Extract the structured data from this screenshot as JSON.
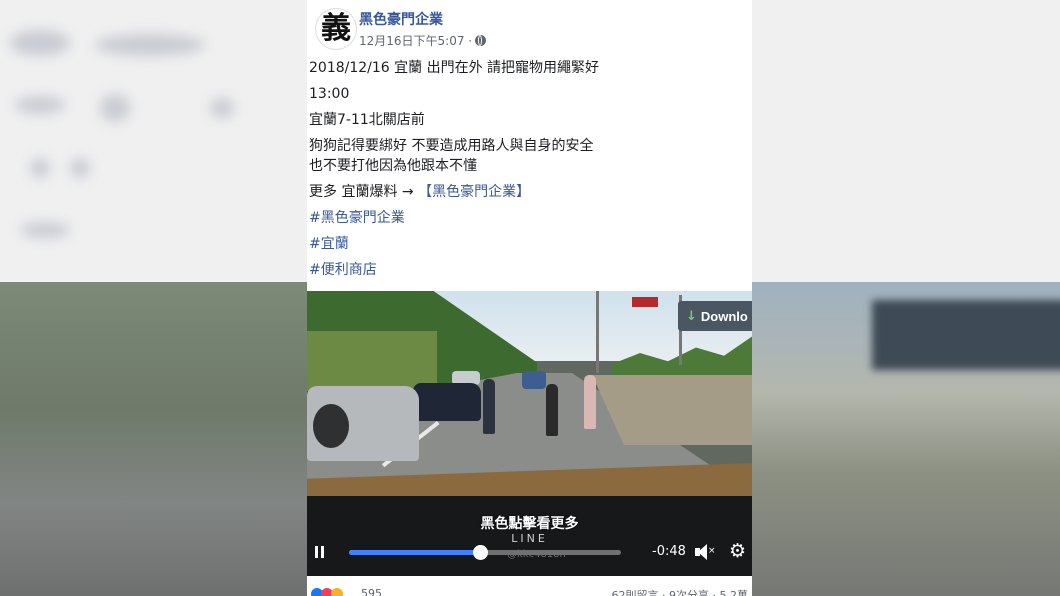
{
  "post": {
    "avatar_char": "義",
    "page_name": "黑色豪門企業",
    "timestamp": "12月16日下午5:07 ·",
    "lines": [
      "2018/12/16 宜蘭 出門在外 請把寵物用繩緊好",
      "13:00",
      "宜蘭7-11北關店前",
      "狗狗記得要綁好 不要造成用路人與自身的安全",
      "也不要打他因為他跟本不懂"
    ],
    "more_prefix": "更多 宜蘭爆料 → ",
    "more_link": "【黑色豪門企業】",
    "hashtags": [
      "#黑色豪門企業",
      "#宜蘭",
      "#便利商店"
    ]
  },
  "video": {
    "download_label": "Downlo",
    "overlay_cta": "黑色點擊看更多",
    "overlay_line": "LINE",
    "overlay_id": "@kkc4818n",
    "time_remaining": "-0:48",
    "progress_fraction": 0.48,
    "colors": {
      "progress": "#4080ff"
    }
  },
  "reactions": {
    "count": "595",
    "right_text": "62則留言 · 9次分享 · 5.2萬"
  }
}
